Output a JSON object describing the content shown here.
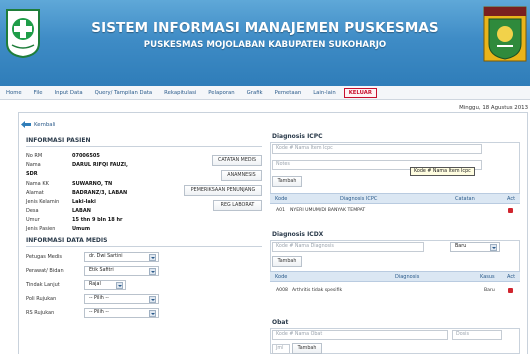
{
  "header": {
    "title": "SISTEM INFORMASI MANAJEMEN PUSKESMAS",
    "subtitle": "PUSKESMAS MOJOLABAN KABUPATEN SUKOHARJO",
    "left_logo_text": "BAKTI HUSADA",
    "right_logo_text": "KABUPATEN SUKOHARJO"
  },
  "menu": [
    "Home",
    "File",
    "Input Data",
    "Query/ Tampilan Data",
    "Rekapitulasi",
    "Pelaporan",
    "Grafik",
    "Pemetaan",
    "Lain-lain"
  ],
  "menu_logout": "KELUAR",
  "date": "Minggu, 18 Agustus 2013",
  "back_label": "Kembali",
  "patient": {
    "section_title": "INFORMASI PASIEN",
    "fields": [
      {
        "label": "No RM",
        "value": "07006505"
      },
      {
        "label": "Nama",
        "value": "DARUL RIFQI FAUZI,"
      },
      {
        "label": "SDR",
        "value": ""
      },
      {
        "label": "Nama KK",
        "value": "SUWARNO, TN"
      },
      {
        "label": "Alamat",
        "value": "BADRANZ/3, LABAN"
      },
      {
        "label": "Jenis Kelamin",
        "value": "Laki-laki"
      },
      {
        "label": "Desa",
        "value": "LABAN"
      },
      {
        "label": "Umur",
        "value": "15 thn 9 bln 18 hr"
      },
      {
        "label": "Jenis Pasien",
        "value": "Umum"
      }
    ],
    "buttons": [
      "CATATAN MEDIS",
      "ANAMNESIS",
      "PEMERIKSAAN PENUNJANG",
      "REG LABORAT"
    ]
  },
  "medis": {
    "section_title": "INFORMASI DATA MEDIS",
    "fields": [
      {
        "label": "Petugas Medis",
        "value": "dr. Dwi Sartini"
      },
      {
        "label": "Perawat/ Bidan",
        "value": "Etik Safitri"
      },
      {
        "label": "Tindak Lanjut",
        "value": "Rajal"
      },
      {
        "label": "Poli Rujukan",
        "value": "-- Pilih --"
      },
      {
        "label": "RS Rujukan",
        "value": "-- Pilih --"
      }
    ]
  },
  "icpc": {
    "title": "Diagnosis ICPC",
    "input_placeholder": "Kode # Nama Item Icpc",
    "notes_placeholder": "Notes",
    "add_button": "Tambah",
    "tooltip": "Kode # Nama Item Icpc",
    "columns": [
      "Kode",
      "Diagnosis ICPC",
      "Catatan",
      "Act"
    ],
    "rows": [
      {
        "kode": "A01",
        "diagnosis": "NYERI UMUM/DI BANYAK TEMPAT",
        "catatan": ""
      }
    ]
  },
  "icdx": {
    "title": "Diagnosis ICDX",
    "input_placeholder": "Kode # Nama Diagnosis",
    "case_select": "Baru",
    "add_button": "Tambah",
    "columns": [
      "Kode",
      "Diagnosis",
      "Kasus",
      "Act"
    ],
    "rows": [
      {
        "kode": "A008",
        "diagnosis": "Arthritis tidak spesifik",
        "kasus": "Baru"
      }
    ]
  },
  "obat": {
    "title": "Obat",
    "input_placeholder": "Kode # Nama Obat",
    "dose_placeholder": "Dosis",
    "qty_placeholder": "Jml",
    "add_button": "Tambah"
  }
}
